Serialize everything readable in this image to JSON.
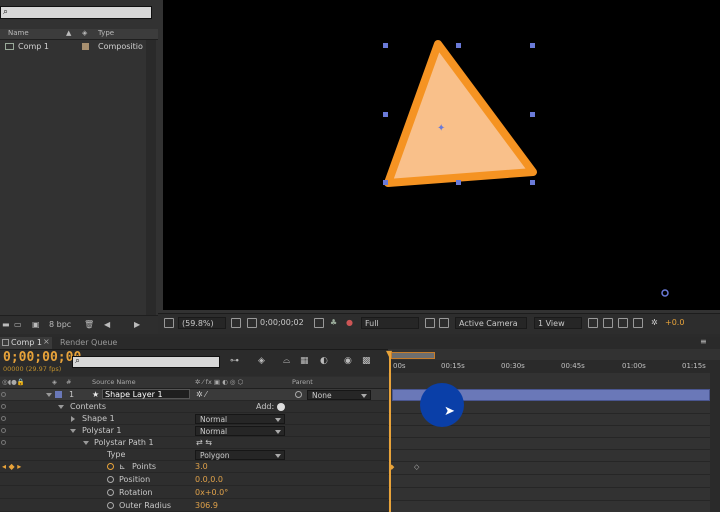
{
  "project": {
    "search_placeholder": "",
    "col_name": "Name",
    "col_type": "Type",
    "items": [
      {
        "name": "Comp 1",
        "type": "Compositio"
      }
    ],
    "bpc": "8 bpc"
  },
  "viewer": {
    "zoom": "(59.8%)",
    "timecode": "0;00;00;02",
    "resolution": "Full",
    "camera": "Active Camera",
    "views": "1 View",
    "exposure": "+0.0",
    "shape_fill": "#f9c08a",
    "shape_stroke": "#f59322"
  },
  "timeline": {
    "tabs": [
      {
        "label": "Comp 1"
      },
      {
        "label": "Render Queue"
      }
    ],
    "timecode": "0;00;00;00",
    "fps": "00000 (29.97 fps)",
    "col_source": "Source Name",
    "col_parent": "Parent",
    "ruler": [
      "00s",
      "00:15s",
      "00:30s",
      "00:45s",
      "01:00s",
      "01:15s"
    ],
    "layer": {
      "num": "1",
      "name": "Shape Layer 1",
      "parent": "None"
    },
    "contents": "Contents",
    "add_label": "Add:",
    "shape1": "Shape 1",
    "shape1_mode": "Normal",
    "polystar1": "Polystar 1",
    "polystar1_mode": "Normal",
    "polystar_path": "Polystar Path 1",
    "type_label": "Type",
    "type_value": "Polygon",
    "props": [
      {
        "label": "Points",
        "value": "3.0"
      },
      {
        "label": "Position",
        "value": "0.0,0.0"
      },
      {
        "label": "Rotation",
        "value": "0x+0.0°"
      },
      {
        "label": "Outer Radius",
        "value": "306.9"
      }
    ],
    "layer_color": "#6a78b8",
    "accent": "#e8a33a"
  }
}
